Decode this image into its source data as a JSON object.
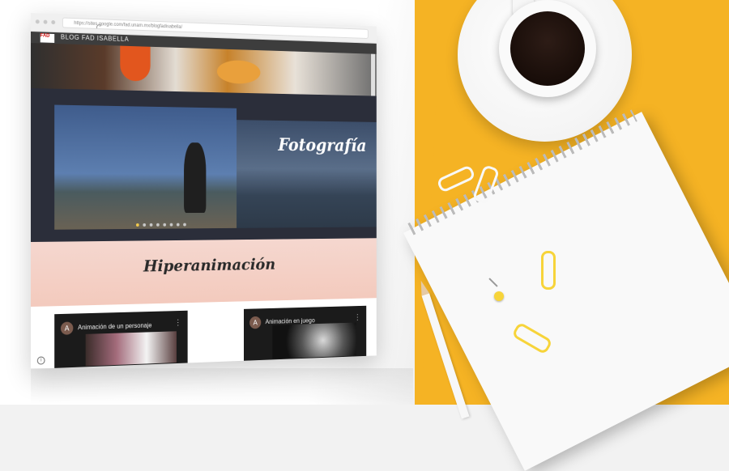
{
  "browser": {
    "url": "https://sites.google.com/fad.unam.mx/blogfadisabella/"
  },
  "site": {
    "logo_text": "FAD",
    "title": "BLOG FAD ISABELLA"
  },
  "hero": {
    "title": "Fotografía",
    "slide_count": 8,
    "active_slide": 1
  },
  "section": {
    "title": "Hiperanimación"
  },
  "cards": [
    {
      "avatar": "A",
      "title": "Animación de un personaje"
    },
    {
      "avatar": "A",
      "title": "Animación en juego"
    }
  ],
  "icons": {
    "more": "more-vertical-icon",
    "info": "info-icon",
    "reload": "reload-icon"
  },
  "colors": {
    "desk_yellow": "#f5b324",
    "section_pink": "#f5d7cf",
    "carousel_active": "#f2c94c"
  }
}
